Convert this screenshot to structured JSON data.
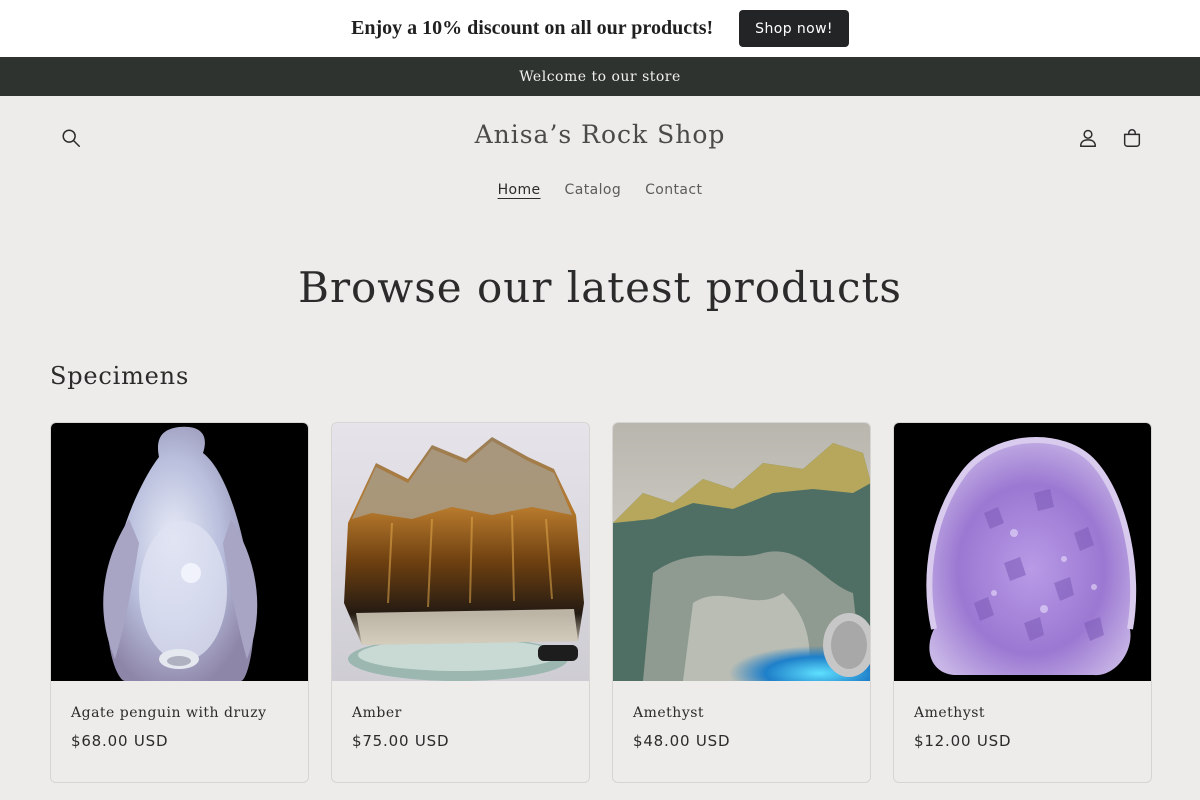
{
  "promo": {
    "text": "Enjoy a 10% discount on all our products!",
    "button_label": "Shop now!"
  },
  "announcement": {
    "text": "Welcome to our store"
  },
  "header": {
    "store_name": "Anisa’s Rock Shop",
    "icons": {
      "search": "search-icon",
      "account": "account-icon",
      "cart": "cart-icon"
    },
    "nav": [
      {
        "label": "Home",
        "active": true
      },
      {
        "label": "Catalog",
        "active": false
      },
      {
        "label": "Contact",
        "active": false
      }
    ]
  },
  "main": {
    "hero_heading": "Browse our latest products",
    "section_heading": "Specimens",
    "products": [
      {
        "name": "Agate penguin with druzy",
        "price": "$68.00 USD"
      },
      {
        "name": "Amber",
        "price": "$75.00 USD"
      },
      {
        "name": "Amethyst",
        "price": "$48.00 USD"
      },
      {
        "name": "Amethyst",
        "price": "$12.00 USD"
      }
    ]
  },
  "colors": {
    "page_background": "#edecea",
    "announcement_background": "#2e3330",
    "button_background": "#222426",
    "text": "#2b2b2b"
  }
}
